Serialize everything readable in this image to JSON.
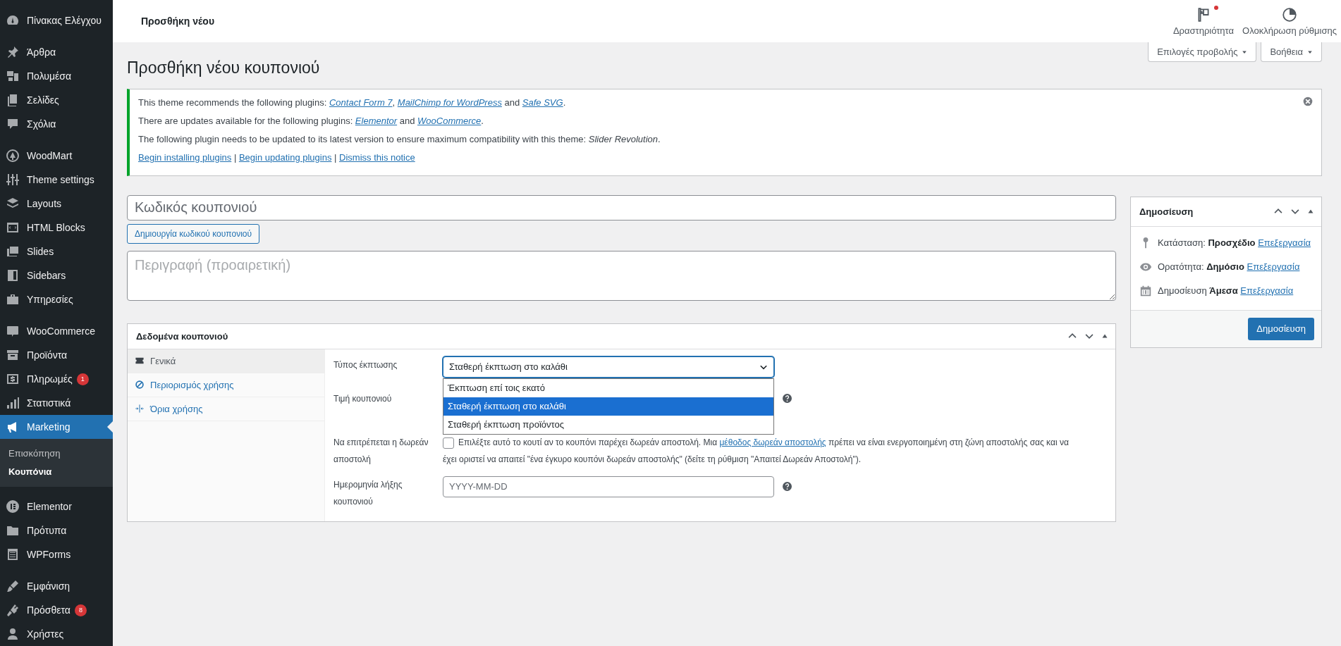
{
  "sidebar": {
    "groups": [
      [
        {
          "label": "Πίνακας Ελέγχου",
          "selected": false
        }
      ],
      [
        {
          "label": "Άρθρα",
          "selected": false
        },
        {
          "label": "Πολυμέσα",
          "selected": false
        },
        {
          "label": "Σελίδες",
          "selected": false
        },
        {
          "label": "Σχόλια",
          "selected": false
        }
      ],
      [
        {
          "label": "WoodMart",
          "selected": false
        },
        {
          "label": "Theme settings",
          "selected": false
        },
        {
          "label": "Layouts",
          "selected": false
        },
        {
          "label": "HTML Blocks",
          "selected": false
        },
        {
          "label": "Slides",
          "selected": false
        },
        {
          "label": "Sidebars",
          "selected": false
        },
        {
          "label": "Υπηρεσίες",
          "selected": false
        }
      ],
      [
        {
          "label": "WooCommerce",
          "selected": false
        },
        {
          "label": "Προϊόντα",
          "selected": false
        },
        {
          "label": "Πληρωμές",
          "badge": "1",
          "selected": false
        },
        {
          "label": "Στατιστικά",
          "selected": false
        },
        {
          "label": "Marketing",
          "selected": true,
          "children": [
            {
              "label": "Επισκόπηση",
              "selected": false
            },
            {
              "label": "Κουπόνια",
              "selected": true
            }
          ]
        }
      ],
      [
        {
          "label": "Elementor",
          "selected": false
        },
        {
          "label": "Πρότυπα",
          "selected": false
        },
        {
          "label": "WPForms",
          "selected": false
        }
      ],
      [
        {
          "label": "Εμφάνιση",
          "selected": false
        },
        {
          "label": "Πρόσθετα",
          "badge": "8",
          "selected": false
        },
        {
          "label": "Χρήστες",
          "selected": false
        }
      ]
    ]
  },
  "header": {
    "title": "Προσθήκη νέου",
    "actions": [
      {
        "label": "Δραστηριότητα",
        "notification": true
      },
      {
        "label": "Ολοκλήρωση ρύθμισης",
        "notification": false
      }
    ]
  },
  "screen_buttons": [
    "Επιλογές προβολής",
    "Βοήθεια"
  ],
  "heading": "Προσθήκη νέου κουπονιού",
  "notice": {
    "lines": [
      [
        {
          "kind": "text",
          "text": "This theme recommends the following plugins: "
        },
        {
          "kind": "plugin_link",
          "text": "Contact Form 7"
        },
        {
          "kind": "text",
          "text": ", "
        },
        {
          "kind": "plugin_link",
          "text": "MailChimp for WordPress"
        },
        {
          "kind": "text",
          "text": " and "
        },
        {
          "kind": "plugin_link",
          "text": "Safe SVG"
        },
        {
          "kind": "text",
          "text": "."
        }
      ],
      [
        {
          "kind": "text",
          "text": "There are updates available for the following plugins: "
        },
        {
          "kind": "plugin_link",
          "text": "Elementor"
        },
        {
          "kind": "text",
          "text": " and "
        },
        {
          "kind": "plugin_link",
          "text": "WooCommerce"
        },
        {
          "kind": "text",
          "text": "."
        }
      ],
      [
        {
          "kind": "text",
          "text": "The following plugin needs to be updated to its latest version to ensure maximum compatibility with this theme: "
        },
        {
          "kind": "emphasis",
          "text": "Slider Revolution"
        },
        {
          "kind": "text",
          "text": "."
        }
      ],
      [
        {
          "kind": "link",
          "text": "Begin installing plugins"
        },
        {
          "kind": "text",
          "text": " | "
        },
        {
          "kind": "link",
          "text": "Begin updating plugins"
        },
        {
          "kind": "text",
          "text": " | "
        },
        {
          "kind": "link",
          "text": "Dismiss this notice"
        }
      ]
    ]
  },
  "coupon": {
    "code_placeholder": "Κωδικός κουπονιού",
    "generate_button": "Δημιουργία κωδικού κουπονιού",
    "description_placeholder": "Περιγραφή (προαιρετική)"
  },
  "coupon_data": {
    "title": "Δεδομένα κουπονιού",
    "tabs": [
      {
        "label": "Γενικά",
        "selected": true
      },
      {
        "label": "Περιορισμός χρήσης",
        "selected": false
      },
      {
        "label": "Όρια χρήσης",
        "selected": false
      }
    ],
    "fields": [
      {
        "kind": "select",
        "label": "Τύπος έκπτωσης",
        "value": "Σταθερή έκπτωση στο καλάθι",
        "expanded": true,
        "options": [
          {
            "label": "Έκπτωση επί τοις εκατό",
            "selected": false
          },
          {
            "label": "Σταθερή έκπτωση στο καλάθι",
            "selected": true
          },
          {
            "label": "Σταθερή έκπτωση προϊόντος",
            "selected": false
          }
        ]
      },
      {
        "kind": "amount",
        "label": "Τιμή κουπονιού",
        "help": true
      },
      {
        "kind": "checkbox",
        "label": "Να επιτρέπεται η δωρεάν αποστολή",
        "checked": false,
        "text_before": "Επιλέξτε αυτό το κουτί αν το κουπόνι παρέχει δωρεάν αποστολή. Μια ",
        "link": "μέθοδος δωρεάν αποστολής",
        "text_after": " πρέπει να είναι ενεργοποιημένη στη ζώνη αποστολής σας και να έχει οριστεί να απαιτεί \"ένα έγκυρο κουπόνι δωρεάν αποστολής\" (δείτε τη ρύθμιση \"Απαιτεί Δωρεάν Αποστολή\")."
      },
      {
        "kind": "date",
        "label": "Ημερομηνία λήξης κουπονιού",
        "placeholder": "YYYY-MM-DD",
        "help": true
      }
    ]
  },
  "publish": {
    "title": "Δημοσίευση",
    "rows": [
      {
        "label": "Κατάσταση:",
        "value": "Προσχέδιο",
        "link": "Επεξεργασία"
      },
      {
        "label": "Ορατότητα:",
        "value": "Δημόσιο",
        "link": "Επεξεργασία"
      },
      {
        "label": "Δημοσίευση",
        "value": "Άμεσα",
        "link": "Επεξεργασία"
      }
    ],
    "button": "Δημοσίευση"
  }
}
